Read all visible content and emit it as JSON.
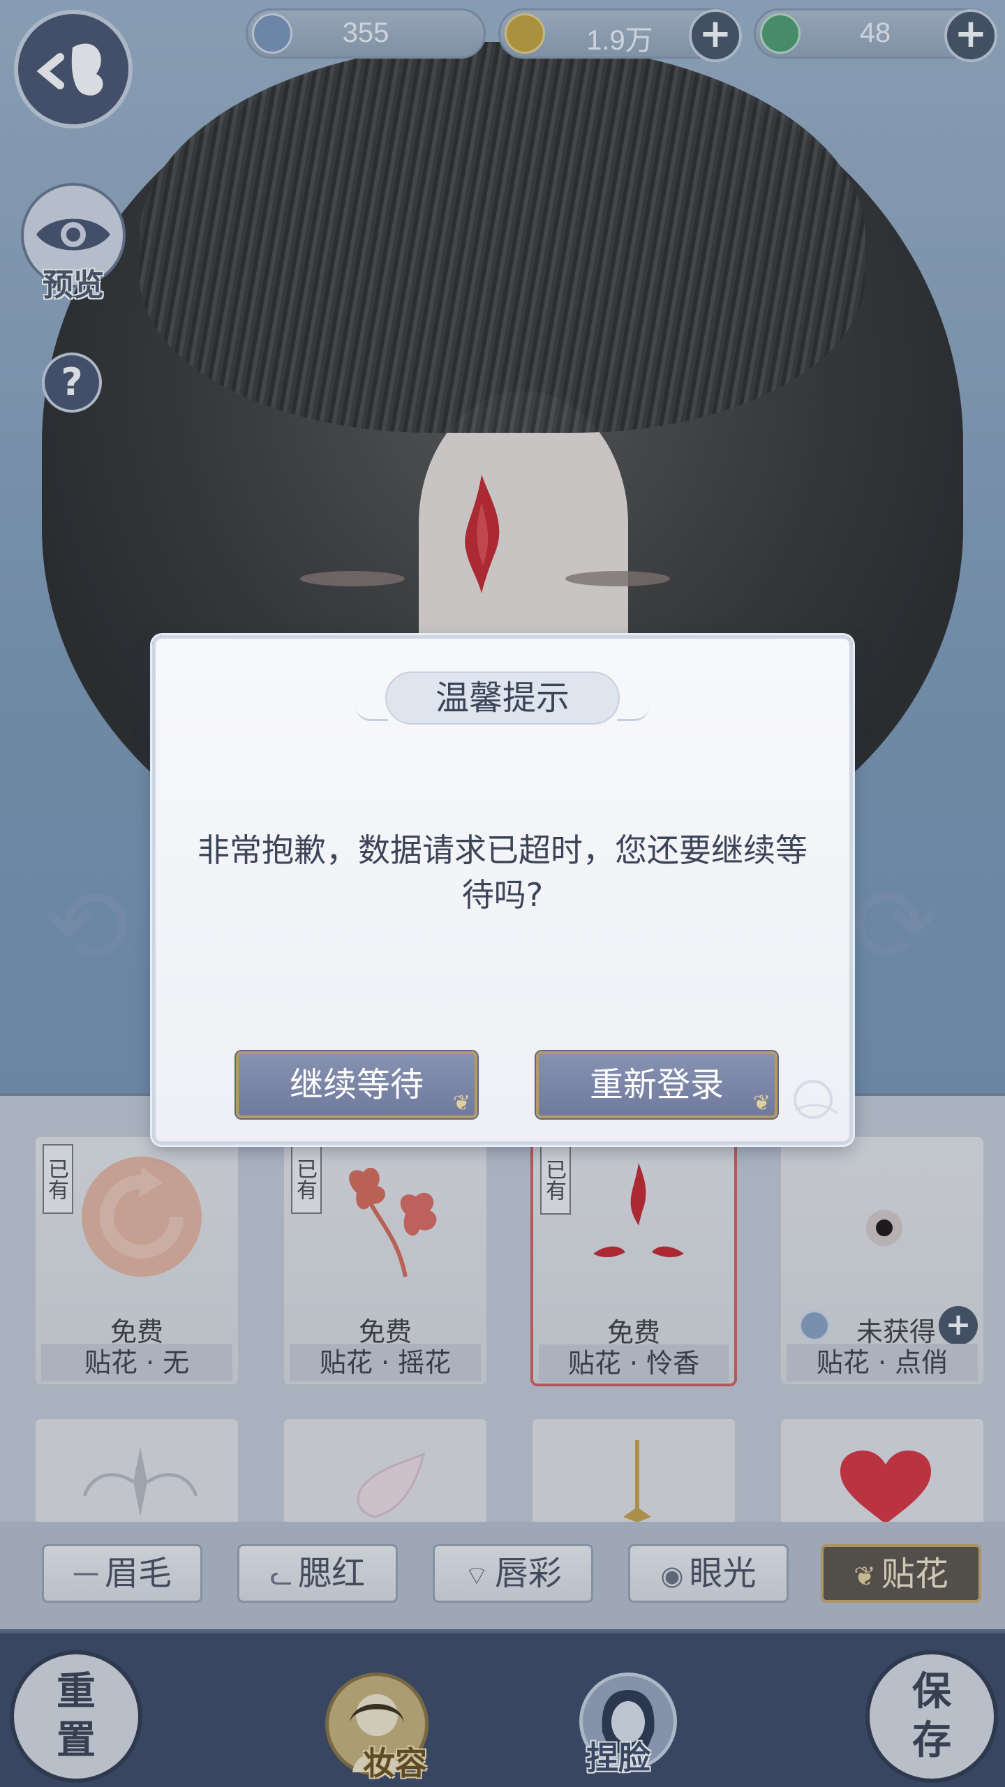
{
  "currency": {
    "silver": "355",
    "coins": "1.9万",
    "jade": "48"
  },
  "side": {
    "preview_label": "预览",
    "help_label": "?"
  },
  "cards": [
    {
      "owned": "已有",
      "price": "免费",
      "name": "贴花 · 无"
    },
    {
      "owned": "已有",
      "price": "免费",
      "name": "贴花 · 摇花"
    },
    {
      "owned": "已有",
      "price": "免费",
      "name": "贴花 · 怜香"
    },
    {
      "owned": "",
      "price": "未获得",
      "name": "贴花 · 点俏"
    }
  ],
  "tabs": [
    {
      "label": "眉毛",
      "glyph": "一"
    },
    {
      "label": "腮红",
      "glyph": "ᓚ"
    },
    {
      "label": "唇彩",
      "glyph": "⌔"
    },
    {
      "label": "眼光",
      "glyph": "◉"
    },
    {
      "label": "贴花",
      "glyph": "❦"
    }
  ],
  "nav": {
    "reset_1": "重",
    "reset_2": "置",
    "makeup": "妆容",
    "face": "捏脸",
    "save_1": "保",
    "save_2": "存"
  },
  "dialog": {
    "title": "温馨提示",
    "message": "非常抱歉，数据请求已超时，您还要继续等待吗?",
    "wait_button": "继续等待",
    "relogin_button": "重新登录"
  },
  "colors": {
    "dialog_button": "#7a84a6",
    "active_tab": "#5c5448",
    "selected_card_border": "#d46060"
  }
}
